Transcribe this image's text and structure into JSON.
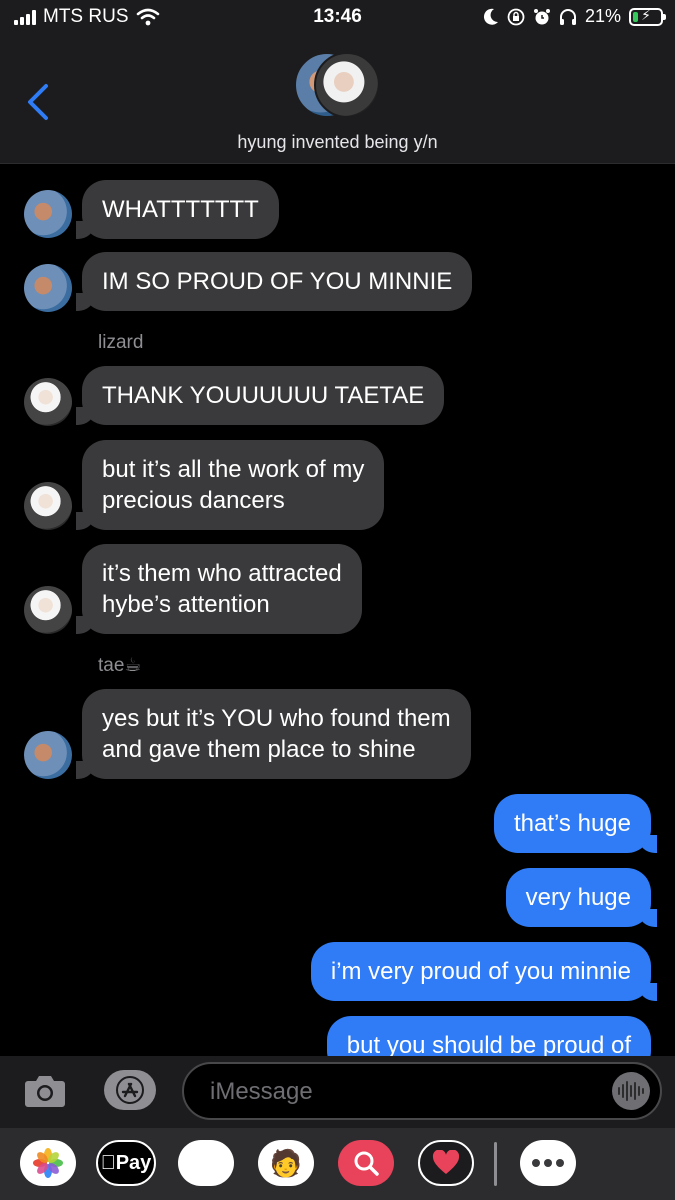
{
  "status_bar": {
    "carrier": "MTS RUS",
    "time": "13:46",
    "battery_percent": "21%",
    "battery_level": 0.21,
    "icons": [
      "cellular-signal-icon",
      "wifi-icon",
      "moon-icon",
      "rotation-lock-icon",
      "alarm-icon",
      "headphones-icon",
      "battery-charging-icon"
    ]
  },
  "header": {
    "back_icon": "chevron-left-icon",
    "title": "hyung invented being y/n"
  },
  "messages": [
    {
      "side": "in",
      "avatar": "tae",
      "text": "WHATTTTTTT"
    },
    {
      "side": "in",
      "avatar": "tae",
      "text": "IM SO PROUD OF YOU MINNIE"
    },
    {
      "side": "sender",
      "text": "lizard"
    },
    {
      "side": "in",
      "avatar": "lizard",
      "text": "THANK YOUUUUUU TAETAE"
    },
    {
      "side": "in",
      "avatar": "lizard",
      "line1": "but it’s all the work of my",
      "line2": "precious dancers"
    },
    {
      "side": "in",
      "avatar": "lizard",
      "line1": "it’s them who attracted",
      "line2": "hybe’s attention"
    },
    {
      "side": "sender",
      "text": "tae☕"
    },
    {
      "side": "in",
      "avatar": "tae",
      "line1": "yes but it’s YOU who found them",
      "line2": "and gave them place to shine"
    },
    {
      "side": "out",
      "text": "that’s huge"
    },
    {
      "side": "out",
      "text": "very huge"
    },
    {
      "side": "out",
      "text": "i’m very proud of you minnie"
    },
    {
      "side": "out",
      "text": "but you should be proud of"
    }
  ],
  "input_bar": {
    "placeholder": "iMessage",
    "icons": [
      "camera-icon",
      "app-store-icon",
      "voice-waveform-icon"
    ]
  },
  "app_drawer": {
    "applepay_label": "Pay",
    "apps": [
      "photos-icon",
      "apple-pay-icon",
      "monkey-memoji-icon",
      "memoji-icon",
      "search-images-icon",
      "digital-touch-icon",
      "more-apps-icon"
    ]
  },
  "colors": {
    "incoming_bubble": "#3a3a3c",
    "outgoing_bubble": "#2f7cf6",
    "background": "#000000"
  }
}
